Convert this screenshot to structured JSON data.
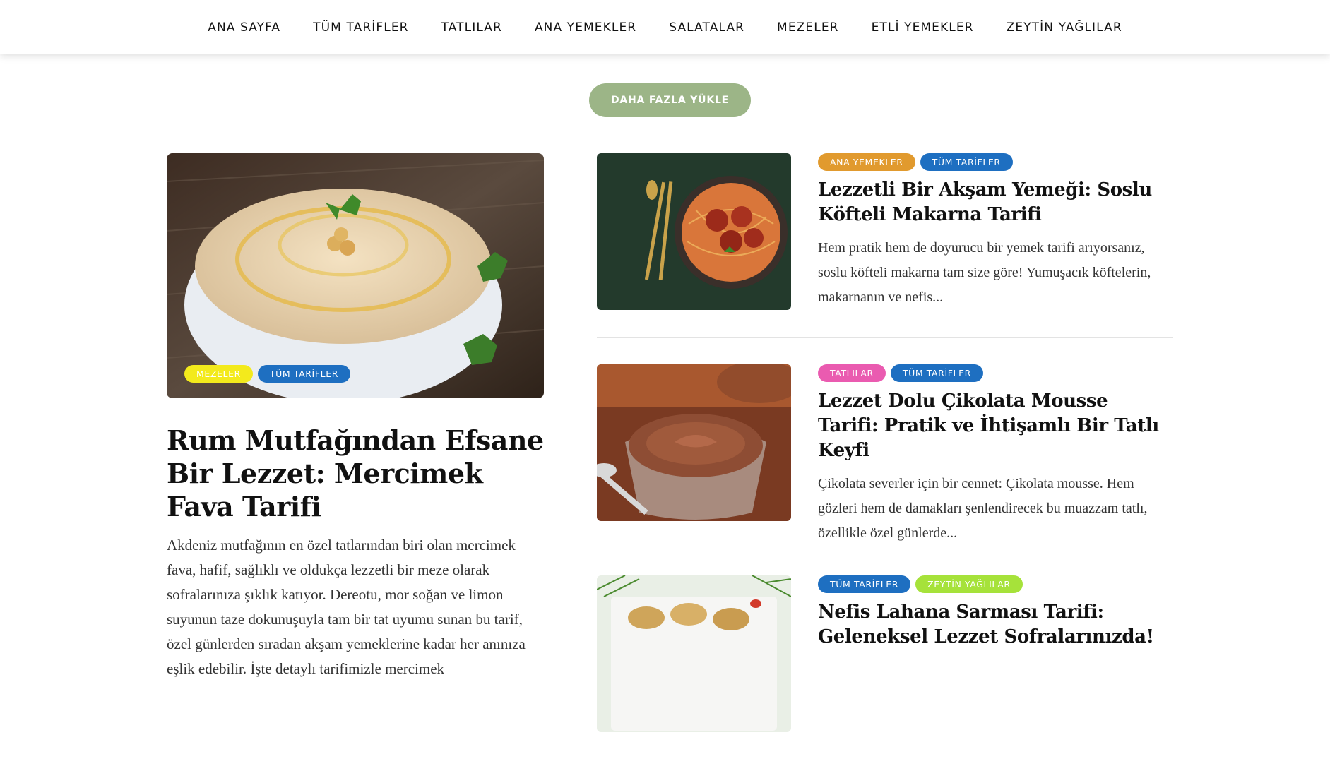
{
  "nav": {
    "items": [
      "ANA SAYFA",
      "TÜM TARİFLER",
      "TATLILAR",
      "ANA YEMEKLER",
      "SALATALAR",
      "MEZELER",
      "ETLİ YEMEKLER",
      "ZEYTİN YAĞLILAR"
    ]
  },
  "load_more": {
    "label": "DAHA FAZLA YÜKLE",
    "color": "#9cb587"
  },
  "featured": {
    "tags": [
      {
        "label": "MEZELER",
        "color": "#f3ea1c"
      },
      {
        "label": "TÜM TARİFLER",
        "color": "#1e6fc1"
      }
    ],
    "title": "Rum Mutfağından Efsane Bir Lezzet: Mercimek Fava Tarifi",
    "excerpt": "Akdeniz mutfağının en özel tatlarından biri olan mercimek fava, hafif, sağlıklı ve oldukça lezzetli bir meze olarak sofralarınıza şıklık katıyor. Dereotu, mor soğan ve limon suyunun taze dokunuşuyla tam bir tat uyumu sunan bu tarif, özel günlerden sıradan akşam yemeklerine kadar her anınıza eşlik edebilir. İşte detaylı tarifimizle mercimek"
  },
  "posts": [
    {
      "tags": [
        {
          "label": "ANA YEMEKLER",
          "color": "#e19a2e"
        },
        {
          "label": "TÜM TARİFLER",
          "color": "#1e6fc1"
        }
      ],
      "title": "Lezzetli Bir Akşam Yemeği: Soslu Köfteli Makarna Tarifi",
      "excerpt": "Hem pratik hem de doyurucu bir yemek tarifi arıyorsanız, soslu köfteli makarna tam size göre! Yumuşacık köftelerin, makarnanın ve nefis..."
    },
    {
      "tags": [
        {
          "label": "TATLILAR",
          "color": "#ea5bb0"
        },
        {
          "label": "TÜM TARİFLER",
          "color": "#1e6fc1"
        }
      ],
      "title": "Lezzet Dolu Çikolata Mousse Tarifi: Pratik ve İhtişamlı Bir Tatlı Keyfi",
      "excerpt": "Çikolata severler için bir cennet: Çikolata mousse. Hem gözleri hem de damakları şenlendirecek bu muazzam tatlı, özellikle özel günlerde..."
    },
    {
      "tags": [
        {
          "label": "TÜM TARİFLER",
          "color": "#1e6fc1"
        },
        {
          "label": "ZEYTİN YAĞLILAR",
          "color": "#a6e23a"
        }
      ],
      "title": "Nefis Lahana Sarması Tarifi: Geleneksel Lezzet Sofralarınızda!",
      "excerpt": ""
    }
  ]
}
